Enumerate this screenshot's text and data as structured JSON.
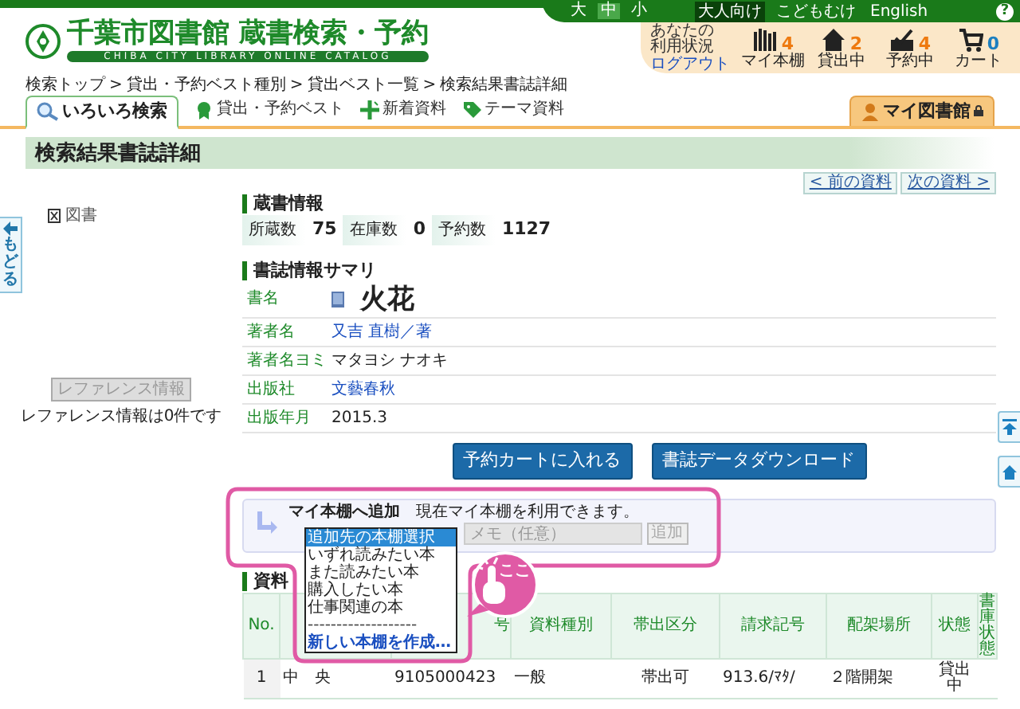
{
  "header": {
    "logo_title": "千葉市図書館 蔵書検索・予約",
    "logo_subtitle": "CHIBA CITY LIBRARY ONLINE CATALOG",
    "font_sizes": [
      {
        "label": "大",
        "selected": false
      },
      {
        "label": "中",
        "selected": true
      },
      {
        "label": "小",
        "selected": false
      }
    ],
    "audiences": [
      {
        "label": "大人向け",
        "selected": true
      },
      {
        "label": "こどもむけ",
        "selected": false
      },
      {
        "label": "English",
        "selected": false
      }
    ],
    "help": "?",
    "usage_link": "あなたの利用状況",
    "logout": "ログアウト",
    "counters": [
      {
        "kind": "shelf",
        "label": "マイ本棚",
        "count": "4"
      },
      {
        "kind": "lending",
        "label": "貸出中",
        "count": "2"
      },
      {
        "kind": "reserve",
        "label": "予約中",
        "count": "4"
      },
      {
        "kind": "cart",
        "label": "カート",
        "count": "0"
      }
    ]
  },
  "breadcrumb_separator": ">",
  "breadcrumb": [
    "検索トップ",
    "貸出・予約ベスト種別",
    "貸出ベスト一覧",
    "検索結果書誌詳細"
  ],
  "tabs": [
    {
      "label": "いろいろ検索",
      "selected": true
    }
  ],
  "nav_links": [
    {
      "kind": "best",
      "label": "貸出・予約ベスト"
    },
    {
      "kind": "new",
      "label": "新着資料"
    },
    {
      "kind": "theme",
      "label": "テーマ資料"
    }
  ],
  "my_library": "マイ図書館",
  "page_title": "検索結果書誌詳細",
  "pager": [
    "< 前の資料",
    "次の資料 >"
  ],
  "back_tab": "もどる",
  "material_type": "図書",
  "reference": {
    "button": "レファレンス情報",
    "disabled": true,
    "note": "レファレンス情報は0件です"
  },
  "holdings": {
    "title": "蔵書情報",
    "stats": [
      {
        "label": "所蔵数",
        "value": "75"
      },
      {
        "label": "在庫数",
        "value": "0"
      },
      {
        "label": "予約数",
        "value": "1127"
      }
    ]
  },
  "summary": {
    "title": "書誌情報サマリ",
    "rows": [
      {
        "kind": "title",
        "label": "書名",
        "value": "火花"
      },
      {
        "kind": "link",
        "label": "著者名",
        "value": "又吉 直樹／著"
      },
      {
        "kind": "text",
        "label": "著者名ヨミ",
        "value": "マタヨシ ナオキ"
      },
      {
        "kind": "link",
        "label": "出版社",
        "value": "文藝春秋"
      },
      {
        "kind": "text",
        "label": "出版年月",
        "value": "2015.3"
      }
    ]
  },
  "actions": [
    "予約カートに入れる",
    "書誌データダウンロード"
  ],
  "bookshelf": {
    "title": "マイ本棚へ追加",
    "notice": "現在マイ本棚を利用できます。",
    "memo_placeholder": "メモ（任意）",
    "add_button": "追加",
    "options": [
      {
        "kind": "option",
        "label": "追加先の本棚選択",
        "selected": true
      },
      {
        "kind": "option",
        "label": "いずれ読みたい本",
        "selected": false
      },
      {
        "kind": "option",
        "label": "また読みたい本",
        "selected": false
      },
      {
        "kind": "option",
        "label": "購入したい本",
        "selected": false
      },
      {
        "kind": "option",
        "label": "仕事関連の本",
        "selected": false
      },
      {
        "kind": "separator",
        "label": "-------------------",
        "selected": false
      },
      {
        "kind": "create",
        "label": "新しい本棚を作成…",
        "selected": false
      }
    ]
  },
  "callout": "ここ",
  "items": {
    "title": "資料",
    "columns": [
      {
        "label": "No."
      },
      {},
      {
        "label": "号"
      },
      {
        "label": "資料種別"
      },
      {
        "label": "帯出区分"
      },
      {
        "label": "請求記号"
      },
      {
        "label": "配架場所"
      },
      {
        "label": "状態"
      },
      {
        "label": "書庫状態"
      }
    ],
    "rows": [
      [
        "1",
        "中　央",
        "9105000423",
        "一般",
        "帯出可",
        "913.6/ﾏﾀ/",
        "２階開架",
        "貸出中"
      ]
    ]
  }
}
